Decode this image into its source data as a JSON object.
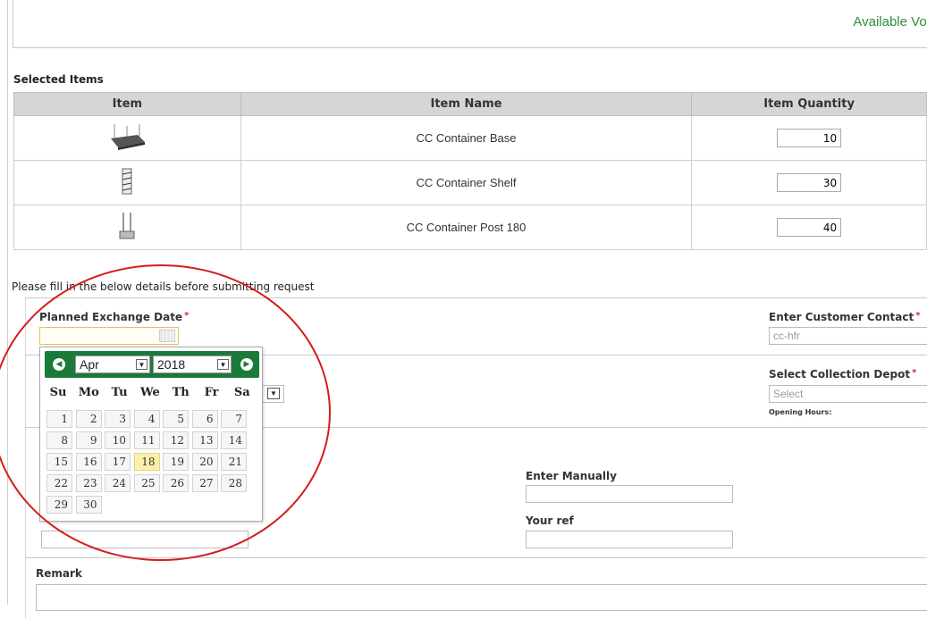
{
  "header": {
    "available_label": "Available Vol"
  },
  "selected_items": {
    "title": "Selected Items",
    "columns": [
      "Item",
      "Item Name",
      "Item Quantity"
    ],
    "rows": [
      {
        "image": "cc-container-base-image",
        "name": "CC Container Base",
        "quantity": "10"
      },
      {
        "image": "cc-container-shelf-image",
        "name": "CC Container Shelf",
        "quantity": "30"
      },
      {
        "image": "cc-container-post-image",
        "name": "CC Container Post 180",
        "quantity": "40"
      }
    ]
  },
  "form": {
    "note": "Please fill in the below details before submitting request",
    "planned_exchange_date_label": "Planned Exchange Date",
    "customer_contact_label": "Enter Customer Contact",
    "customer_contact_value": "cc-hfr",
    "collection_depot_label": "Select Collection Depot",
    "collection_depot_value": "Select",
    "opening_hours_label": "Opening Hours:",
    "enter_manually_label": "Enter Manually",
    "your_ref_label": "Your ref",
    "remark_label": "Remark",
    "required_mark": "*"
  },
  "calendar": {
    "month": "Apr",
    "year": "2018",
    "weekdays": [
      "Su",
      "Mo",
      "Tu",
      "We",
      "Th",
      "Fr",
      "Sa"
    ],
    "days": [
      "1",
      "2",
      "3",
      "4",
      "5",
      "6",
      "7",
      "8",
      "9",
      "10",
      "11",
      "12",
      "13",
      "14",
      "15",
      "16",
      "17",
      "18",
      "19",
      "20",
      "21",
      "22",
      "23",
      "24",
      "25",
      "26",
      "27",
      "28",
      "29",
      "30"
    ],
    "today": "18",
    "prev_icon": "prev-arrow-icon",
    "next_icon": "next-arrow-icon"
  },
  "colors": {
    "accent_green": "#1a7a3a",
    "annotation_red": "#d41c1c",
    "today_highlight": "#fcefae"
  }
}
